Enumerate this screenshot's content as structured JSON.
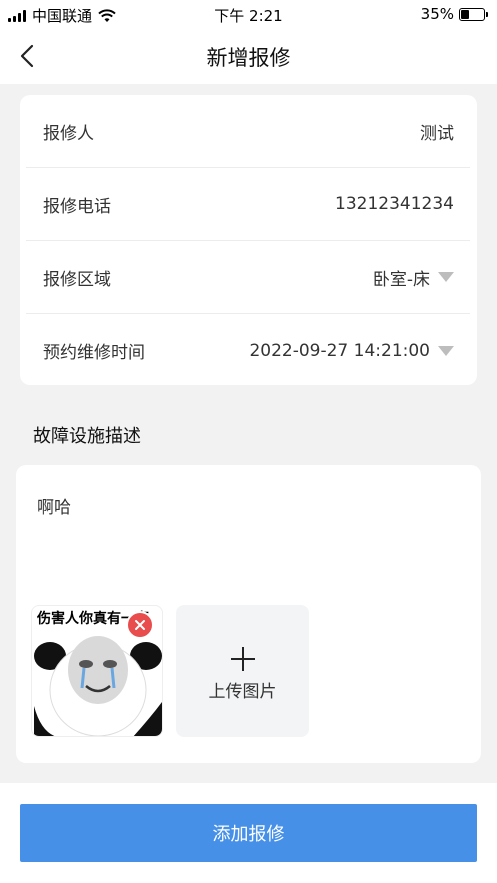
{
  "status_bar": {
    "carrier": "中国联通",
    "time": "下午 2:21",
    "battery_percent": "35%",
    "battery_level": 0.35,
    "wifi_icon": "wifi-icon"
  },
  "nav": {
    "title": "新增报修",
    "back_icon": "chevron-left-icon"
  },
  "form": {
    "reporter": {
      "label": "报修人",
      "value": "测试"
    },
    "phone": {
      "label": "报修电话",
      "value": "13212341234"
    },
    "area": {
      "label": "报修区域",
      "value": "卧室-床"
    },
    "appointment": {
      "label": "预约维修时间",
      "value": "2022-09-27 14:21:00"
    }
  },
  "description": {
    "section_title": "故障设施描述",
    "text": "啊哈",
    "image_caption": "伤害人你真有一套",
    "upload_label": "上传图片"
  },
  "submit_label": "添加报修",
  "colors": {
    "accent": "#4690e8",
    "remove": "#e84c4c",
    "background": "#f2f2f2"
  }
}
